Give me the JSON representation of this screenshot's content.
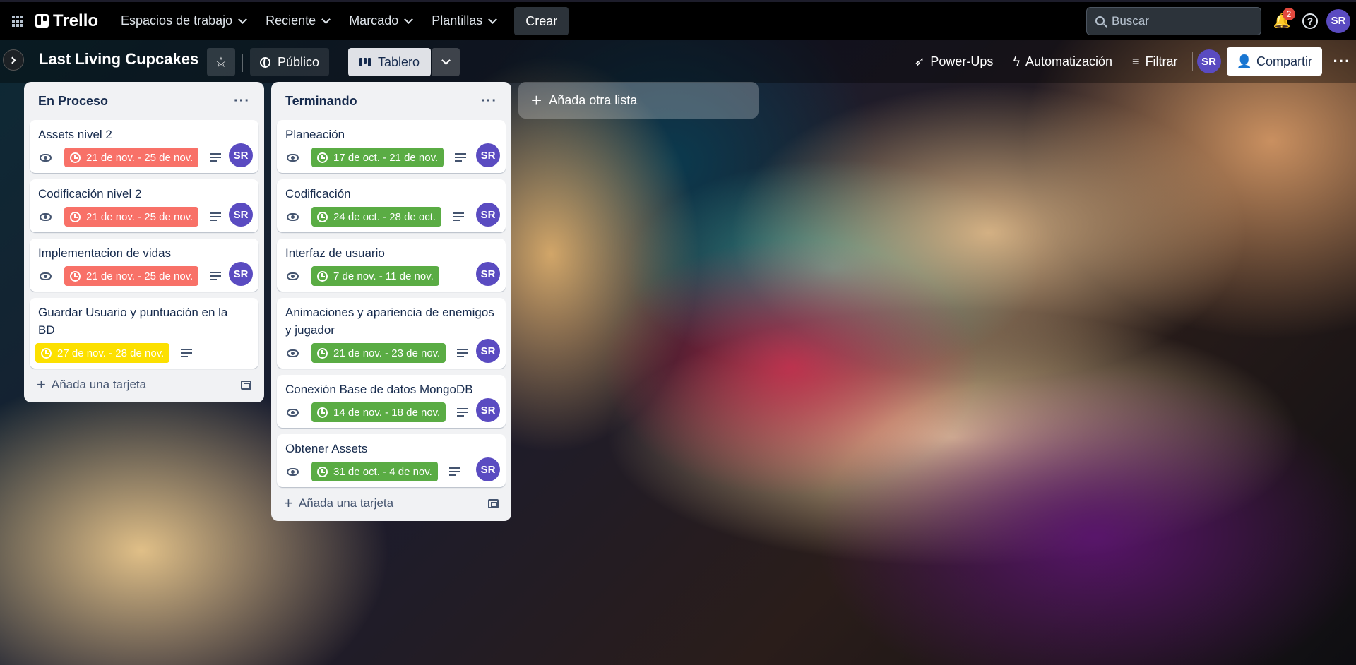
{
  "topbar": {
    "logo": "Trello",
    "nav": [
      {
        "label": "Espacios de trabajo"
      },
      {
        "label": "Reciente"
      },
      {
        "label": "Marcado"
      },
      {
        "label": "Plantillas"
      }
    ],
    "create_label": "Crear",
    "search_placeholder": "Buscar",
    "notifications_count": "2",
    "user_initials": "SR"
  },
  "board": {
    "title": "Last Living Cupcakes",
    "visibility": "Público",
    "view": "Tablero",
    "powerups": "Power-Ups",
    "automation": "Automatización",
    "filter": "Filtrar",
    "member_initials": "SR",
    "share": "Compartir"
  },
  "colors": {
    "red": "#f87168",
    "green": "#5aac44",
    "yellow": "#fce000",
    "avatar": "#5a4bc1"
  },
  "lists": [
    {
      "title": "En Proceso",
      "add_card": "Añada una tarjeta",
      "cards": [
        {
          "title": "Assets nivel 2",
          "due": "21 de nov. - 25 de nov.",
          "status": "red",
          "member": "SR"
        },
        {
          "title": "Codificación nivel 2",
          "due": "21 de nov. - 25 de nov.",
          "status": "red",
          "member": "SR"
        },
        {
          "title": "Implementacion de vidas",
          "due": "21 de nov. - 25 de nov.",
          "status": "red",
          "member": "SR"
        },
        {
          "title": "Guardar Usuario y puntuación en la BD",
          "due": "27 de nov. - 28 de nov.",
          "status": "yellow",
          "member": ""
        }
      ]
    },
    {
      "title": "Terminando",
      "add_card": "Añada una tarjeta",
      "cards": [
        {
          "title": "Planeación",
          "due": "17 de oct. - 21 de nov.",
          "status": "green",
          "member": "SR"
        },
        {
          "title": "Codificación",
          "due": "24 de oct. - 28 de oct.",
          "status": "green",
          "member": "SR"
        },
        {
          "title": "Interfaz de usuario",
          "due": "7 de nov. - 11 de nov.",
          "status": "green",
          "member": "SR"
        },
        {
          "title": "Animaciones y apariencia de enemigos y jugador",
          "due": "21 de nov. - 23 de nov.",
          "status": "green",
          "member": "SR"
        },
        {
          "title": "Conexión Base de datos MongoDB",
          "due": "14 de nov. - 18 de nov.",
          "status": "green",
          "member": "SR"
        },
        {
          "title": "Obtener Assets",
          "due": "31 de oct. - 4 de nov.",
          "status": "green",
          "member": "SR"
        }
      ]
    }
  ],
  "add_list": "Añada otra lista"
}
